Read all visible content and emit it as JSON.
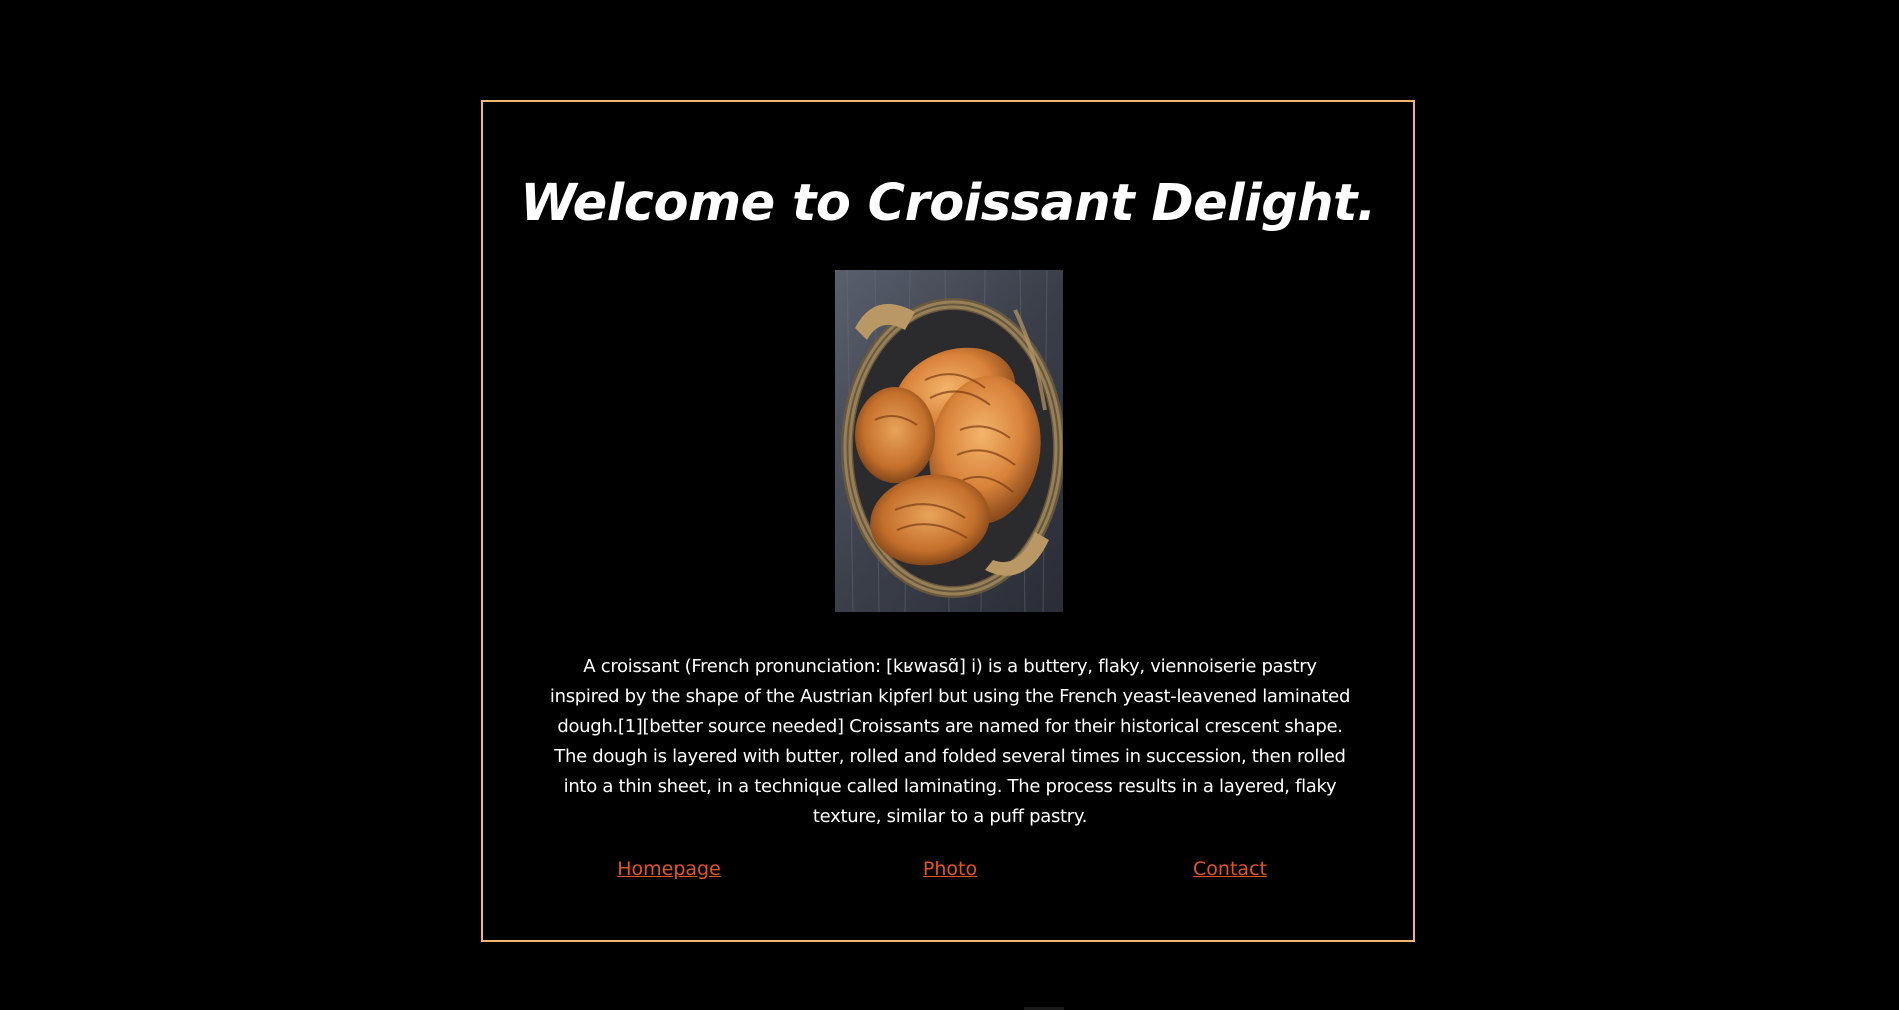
{
  "page": {
    "title": "Welcome to Croissant Delight.",
    "photo_alt": "croissants in a woven basket",
    "description": "A croissant (French pronunciation: [kʁwasɑ̃] i) is a buttery, flaky, viennoiserie pastry inspired by the shape of the Austrian kipferl but using the French yeast-leavened laminated dough.[1][better source needed] Croissants are named for their historical crescent shape. The dough is layered with butter, rolled and folded several times in succession, then rolled into a thin sheet, in a technique called laminating. The process results in a layered, flaky texture, similar to a puff pastry."
  },
  "nav": {
    "links": [
      {
        "label": "Homepage"
      },
      {
        "label": "Photo"
      },
      {
        "label": "Contact"
      }
    ]
  },
  "colors": {
    "background": "#000000",
    "frame_border": "#f2b56b",
    "text": "#ffffff",
    "link": "#e5541c"
  }
}
